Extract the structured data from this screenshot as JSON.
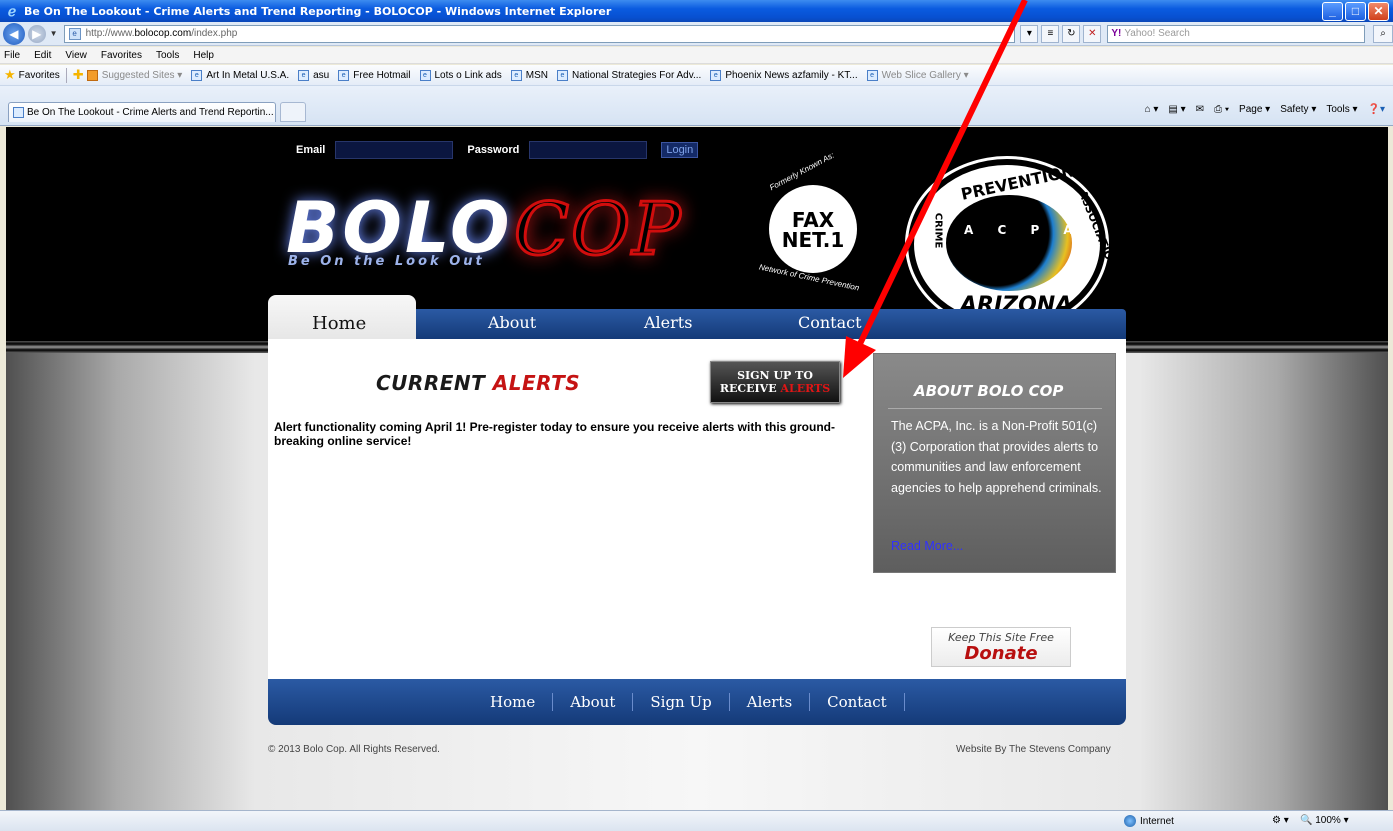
{
  "window": {
    "title": "Be On The Lookout - Crime Alerts and Trend Reporting - BOLOCOP - Windows Internet Explorer"
  },
  "address_bar": {
    "url_prefix": "http://www.",
    "url_domain": "bolocop.com",
    "url_path": "/index.php",
    "search_placeholder": "Yahoo! Search"
  },
  "menu": [
    "File",
    "Edit",
    "View",
    "Favorites",
    "Tools",
    "Help"
  ],
  "favorites_bar": {
    "favorites_label": "Favorites",
    "items": [
      "Suggested Sites ▾",
      "Art In Metal U.S.A.",
      "asu",
      "Free Hotmail",
      "Lots o Link ads",
      "MSN",
      "National Strategies For Adv...",
      "Phoenix News azfamily - KT...",
      "Web Slice Gallery ▾"
    ]
  },
  "tab": {
    "label": "Be On The Lookout - Crime Alerts and Trend Reportin..."
  },
  "command_bar": {
    "page": "Page ▾",
    "safety": "Safety ▾",
    "tools": "Tools ▾"
  },
  "site": {
    "login": {
      "email_label": "Email",
      "password_label": "Password",
      "login_button": "Login"
    },
    "logo": {
      "bolo": "BOLO",
      "cop": "COP",
      "tagline": "Be On the Look Out"
    },
    "faxnet": {
      "top_text": "Formerly Known As:",
      "center_line1": "FAX",
      "center_line2": "NET.1",
      "bottom_text": "Network of Crime Prevention"
    },
    "acpa": {
      "top": "PREVENTION",
      "left": "CRIME",
      "right": "ASSOCIATION",
      "bottom": "ARIZONA",
      "letters": "A C P A"
    },
    "nav": [
      "Home",
      "About",
      "Alerts",
      "Contact"
    ],
    "current_alerts": {
      "word1": "Current",
      "word2": "Alerts"
    },
    "signup_button": {
      "line1": "Sign Up To",
      "line2a": "Receive",
      "line2b": "Alerts"
    },
    "alert_message": "Alert functionality coming April 1! Pre-register today to ensure you receive alerts with this ground-breaking online service!",
    "about": {
      "heading": "ABOUT BOLO COP",
      "body": "The ACPA, Inc. is a Non-Profit 501(c)(3) Corporation that provides alerts to communities and law enforcement agencies to help apprehend criminals.",
      "read_more": "Read More..."
    },
    "donate": {
      "small": "Keep This Site Free",
      "big": "Donate"
    },
    "footer_nav": [
      "Home",
      "About",
      "Sign Up",
      "Alerts",
      "Contact"
    ],
    "copyright": "© 2013 Bolo Cop. All Rights Reserved.",
    "credit": "Website By The Stevens Company"
  },
  "status_bar": {
    "zone": "Internet",
    "zoom": "100%"
  },
  "colors": {
    "nav_blue": "#1d4a8f",
    "alert_red": "#c51313",
    "arrow_red": "#ff0000"
  }
}
